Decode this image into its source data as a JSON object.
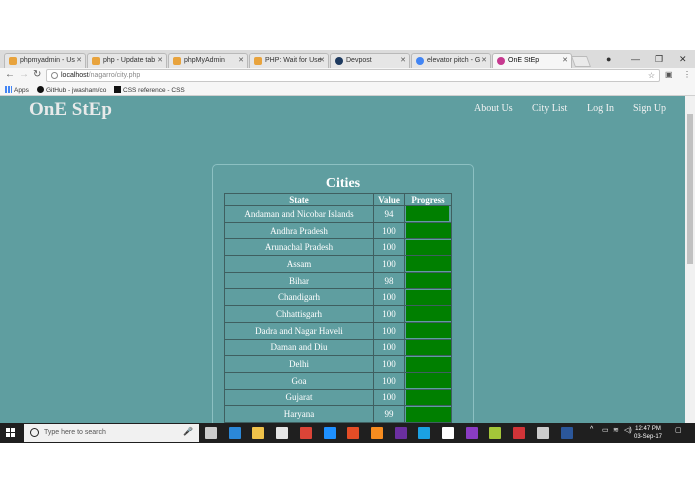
{
  "browser": {
    "tabs": [
      {
        "title": "phpmyadmin - Us",
        "favicon_color": "#e8a33d"
      },
      {
        "title": "php - Update tab",
        "favicon_color": "#e8a33d"
      },
      {
        "title": "phpMyAdmin",
        "favicon_color": "#e8a33d"
      },
      {
        "title": "PHP: Wait for Use",
        "favicon_color": "#e8a33d"
      },
      {
        "title": "Devpost",
        "favicon_color": "#1e3a5f"
      },
      {
        "title": "elevator pitch - G",
        "favicon_color": "#4285f4"
      },
      {
        "title": "OnE StEp",
        "favicon_color": "#c6398f"
      }
    ],
    "url_host": "localhost",
    "url_path": "/nagarro/city.php",
    "bookmarks": [
      {
        "label": "Apps"
      },
      {
        "label": "GitHub - jwasham/co"
      },
      {
        "label": "CSS reference - CSS"
      }
    ]
  },
  "site": {
    "brand": "OnE StEp",
    "nav": [
      "About Us",
      "City List",
      "Log In",
      "Sign Up"
    ]
  },
  "cities": {
    "title": "Cities",
    "headers": [
      "State",
      "Value",
      "Progress"
    ],
    "rows": [
      {
        "state": "Andaman and Nicobar Islands",
        "value": "94",
        "progress": 0.94
      },
      {
        "state": "Andhra Pradesh",
        "value": "100",
        "progress": 1.0
      },
      {
        "state": "Arunachal Pradesh",
        "value": "100",
        "progress": 1.0
      },
      {
        "state": "Assam",
        "value": "100",
        "progress": 1.0
      },
      {
        "state": "Bihar",
        "value": "98",
        "progress": 0.98
      },
      {
        "state": "Chandigarh",
        "value": "100",
        "progress": 1.0
      },
      {
        "state": "Chhattisgarh",
        "value": "100",
        "progress": 1.0
      },
      {
        "state": "Dadra and Nagar Haveli",
        "value": "100",
        "progress": 1.0
      },
      {
        "state": "Daman and Diu",
        "value": "100",
        "progress": 1.0
      },
      {
        "state": "Delhi",
        "value": "100",
        "progress": 1.0
      },
      {
        "state": "Goa",
        "value": "100",
        "progress": 1.0
      },
      {
        "state": "Gujarat",
        "value": "100",
        "progress": 1.0
      },
      {
        "state": "Haryana",
        "value": "99",
        "progress": 0.99
      }
    ]
  },
  "taskbar": {
    "search_placeholder": "Type here to search",
    "apps": [
      "task-view-icon",
      "edge-icon",
      "file-explorer-icon",
      "store-icon",
      "chrome-icon",
      "media-player-icon",
      "office-icon",
      "photos-icon",
      "app-icon",
      "mail-icon",
      "visual-studio-icon",
      "app-icon",
      "onenote-icon",
      "calculator-icon",
      "word-icon",
      "app-icon"
    ],
    "time": "12:47 PM",
    "date": "03-Sep-17"
  },
  "colors": {
    "page_bg": "#5f9ea0",
    "progress_fill": "#007f00",
    "taskbar_bg": "#1f1f1f"
  }
}
